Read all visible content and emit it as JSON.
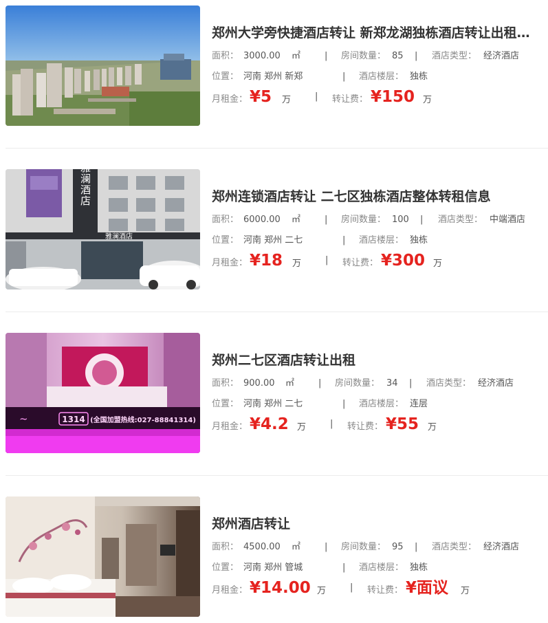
{
  "listings": [
    {
      "title": "郑州大学旁快捷酒店转让 新郑龙湖独栋酒店转让出租…",
      "area_label": "面积：",
      "area_value": "3000.00",
      "area_unit": "㎡",
      "rooms_label": "房间数量：",
      "rooms_value": "85",
      "type_label": "酒店类型：",
      "type_value": "经济酒店",
      "location_label": "位置：",
      "location_value": "河南 郑州 新郑",
      "floor_label": "酒店楼层：",
      "floor_value": "独栋",
      "rent_label": "月租金：",
      "rent_value": "¥5",
      "rent_unit": "万",
      "fee_label": "转让费：",
      "fee_value": "¥150",
      "fee_unit": "万"
    },
    {
      "title": "郑州连锁酒店转让 二七区独栋酒店整体转租信息",
      "area_label": "面积：",
      "area_value": "6000.00",
      "area_unit": "㎡",
      "rooms_label": "房间数量：",
      "rooms_value": "100",
      "type_label": "酒店类型：",
      "type_value": "中端酒店",
      "location_label": "位置：",
      "location_value": "河南 郑州 二七",
      "floor_label": "酒店楼层：",
      "floor_value": "独栋",
      "rent_label": "月租金：",
      "rent_value": "¥18",
      "rent_unit": "万",
      "fee_label": "转让费：",
      "fee_value": "¥300",
      "fee_unit": "万",
      "image_text": {
        "sign_vertical": "雅澜酒店",
        "sign_horizontal": "雅澜酒店"
      }
    },
    {
      "title": "郑州二七区酒店转让出租",
      "area_label": "面积：",
      "area_value": "900.00",
      "area_unit": "㎡",
      "rooms_label": "房间数量：",
      "rooms_value": "34",
      "type_label": "酒店类型：",
      "type_value": "经济酒店",
      "location_label": "位置：",
      "location_value": "河南 郑州 二七",
      "floor_label": "酒店楼层：",
      "floor_value": "连层",
      "rent_label": "月租金：",
      "rent_value": "¥4.2",
      "rent_unit": "万",
      "fee_label": "转让费：",
      "fee_value": "¥55",
      "fee_unit": "万",
      "image_text": {
        "neon_left": "1314",
        "neon_right": "(全国加盟热线:027-88841314)"
      }
    },
    {
      "title": "郑州酒店转让",
      "area_label": "面积：",
      "area_value": "4500.00",
      "area_unit": "㎡",
      "rooms_label": "房间数量：",
      "rooms_value": "95",
      "type_label": "酒店类型：",
      "type_value": "经济酒店",
      "location_label": "位置：",
      "location_value": "河南 郑州 管城",
      "floor_label": "酒店楼层：",
      "floor_value": "独栋",
      "rent_label": "月租金：",
      "rent_value": "¥14.00",
      "rent_unit": "万",
      "fee_label": "转让费：",
      "fee_value": "¥面议",
      "fee_unit": "万"
    }
  ],
  "separator": "|",
  "colors": {
    "price": "#e5231f",
    "title": "#333333",
    "label": "#888888",
    "value": "#555555",
    "divider": "#ececec"
  },
  "icons": [
    "city-aerial-photo",
    "hotel-facade-photo",
    "pink-reception-photo",
    "hotel-room-photo"
  ]
}
